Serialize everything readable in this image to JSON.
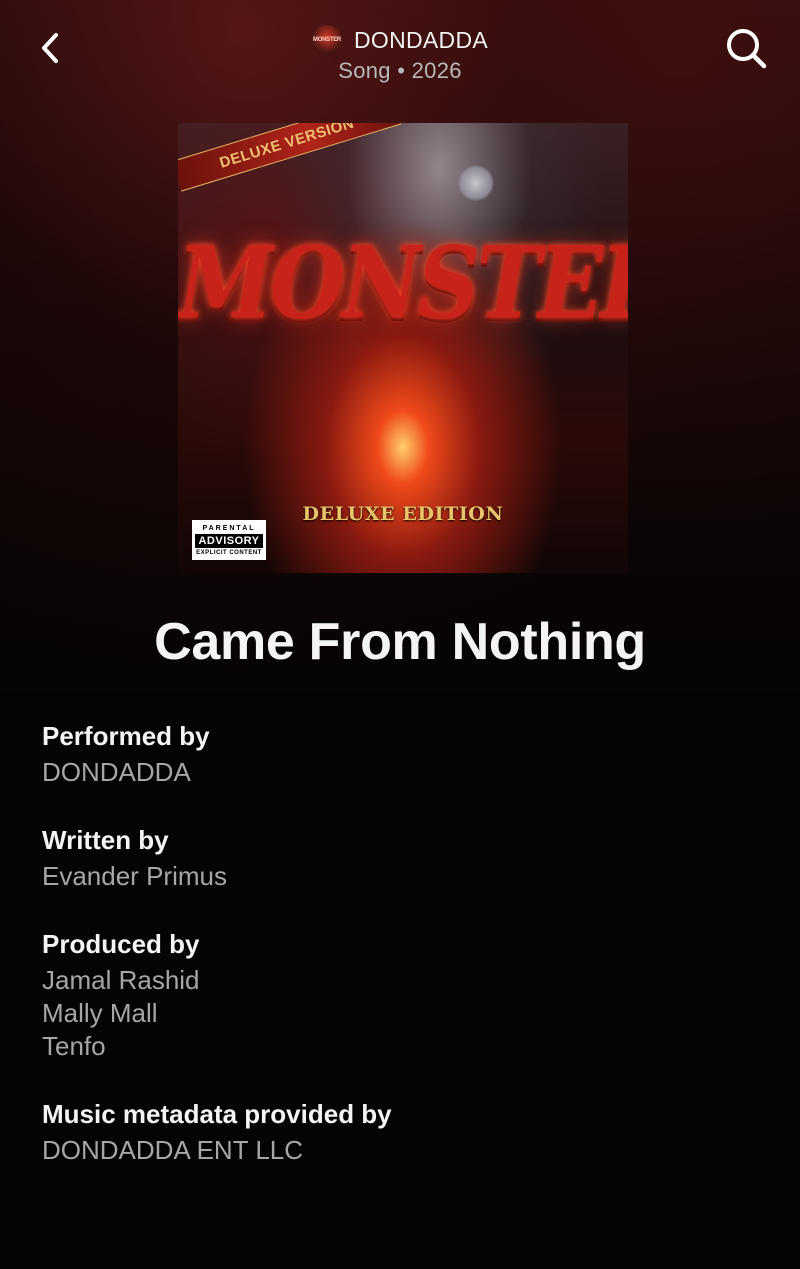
{
  "header": {
    "artist": "DONDADDA",
    "subtitle": "Song • 2026",
    "back_icon": "chevron-left-icon",
    "search_icon": "search-icon"
  },
  "cover": {
    "banner_text": "DELUXE VERSION",
    "title_text": "MONSTER",
    "edition_text": "DELUXE EDITION",
    "advisory_line1": "PARENTAL",
    "advisory_line2": "ADVISORY",
    "advisory_line3": "EXPLICIT CONTENT",
    "accent_color": "#c8231a"
  },
  "song": {
    "title": "Came From Nothing"
  },
  "credits": {
    "performed": {
      "heading": "Performed by",
      "values": [
        "DONDADDA"
      ]
    },
    "written": {
      "heading": "Written by",
      "values": [
        "Evander Primus"
      ]
    },
    "produced": {
      "heading": "Produced by",
      "values": [
        "Jamal Rashid",
        "Mally Mall",
        "Tenfo"
      ]
    },
    "metadata": {
      "heading": "Music metadata provided by",
      "values": [
        "DONDADDA ENT LLC"
      ]
    }
  }
}
